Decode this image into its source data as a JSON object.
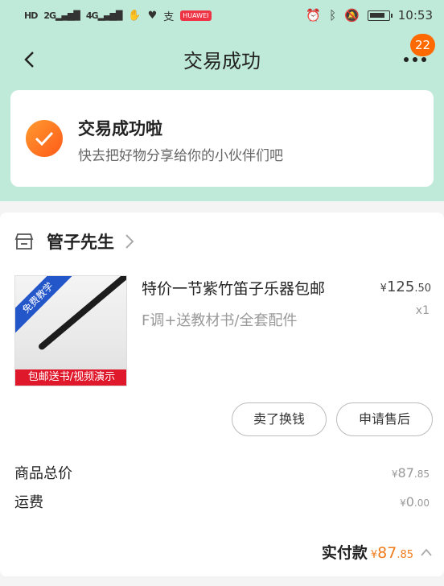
{
  "status": {
    "left_net": "HD",
    "sim1": "2G",
    "sim2": "4G",
    "app_badge": "HUAWEI",
    "time": "10:53",
    "battery_level": 0.85
  },
  "header": {
    "title": "交易成功",
    "message_count": "22"
  },
  "success": {
    "title": "交易成功啦",
    "subtitle": "快去把好物分享给你的小伙伴们吧"
  },
  "shop": {
    "name": "管子先生"
  },
  "product": {
    "title": "特价一节紫竹笛子乐器包邮",
    "spec": "F调+送教材书/全套配件",
    "price_symbol": "¥",
    "price_int": "125",
    "price_dec": ".50",
    "quantity": "x1",
    "image_corner_text": "免费教学",
    "image_bottom_text": "包邮送书/视频演示"
  },
  "actions": {
    "sell_label": "卖了换钱",
    "after_sale_label": "申请售后"
  },
  "summary": {
    "goods_total_label": "商品总价",
    "goods_total_symbol": "¥",
    "goods_total_int": "87",
    "goods_total_dec": ".85",
    "shipping_label": "运费",
    "shipping_symbol": "¥",
    "shipping_int": "0",
    "shipping_dec": ".00",
    "paid_label": "实付款",
    "paid_symbol": "¥",
    "paid_int": "87",
    "paid_dec": ".85"
  },
  "colors": {
    "header_bg": "#bfe9d8",
    "accent_orange": "#ff6a00",
    "price_orange": "#f07c1c"
  },
  "icons": [
    "back-icon",
    "more-icon",
    "check-icon",
    "shop-icon",
    "chevron-right-icon",
    "chevron-up-icon",
    "alarm-icon",
    "bluetooth-icon",
    "mute-icon",
    "battery-icon"
  ]
}
